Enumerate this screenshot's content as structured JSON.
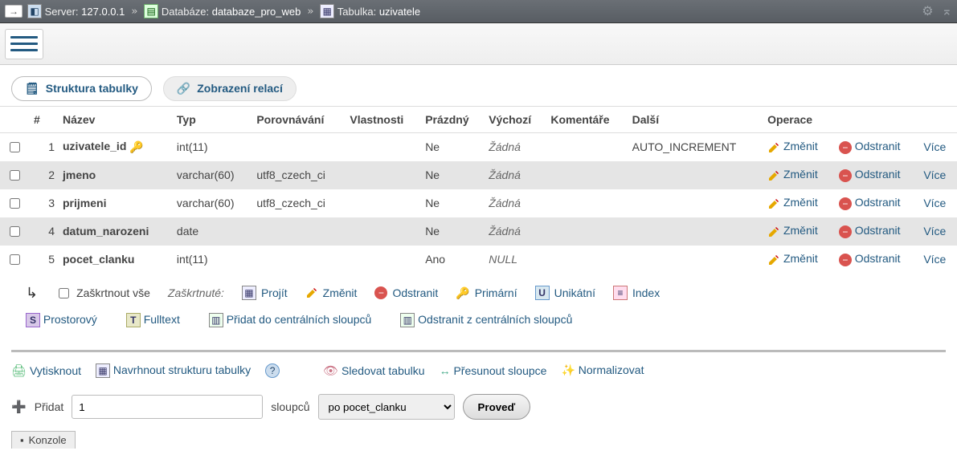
{
  "breadcrumb": {
    "server_label": "Server:",
    "server": "127.0.0.1",
    "db_label": "Databáze:",
    "db": "databaze_pro_web",
    "table_label": "Tabulka:",
    "table": "uzivatele"
  },
  "tabs": {
    "structure": "Struktura tabulky",
    "relations": "Zobrazení relací"
  },
  "columns_header": {
    "num": "#",
    "name": "Název",
    "type": "Typ",
    "collation": "Porovnávání",
    "attributes": "Vlastnosti",
    "null": "Prázdný",
    "default": "Výchozí",
    "comments": "Komentáře",
    "extra": "Další",
    "actions": "Operace"
  },
  "rows": [
    {
      "n": "1",
      "name": "uzivatele_id",
      "primary": true,
      "type": "int(11)",
      "collation": "",
      "null": "Ne",
      "def": "Žádná",
      "extra": "AUTO_INCREMENT"
    },
    {
      "n": "2",
      "name": "jmeno",
      "primary": false,
      "type": "varchar(60)",
      "collation": "utf8_czech_ci",
      "null": "Ne",
      "def": "Žádná",
      "extra": ""
    },
    {
      "n": "3",
      "name": "prijmeni",
      "primary": false,
      "type": "varchar(60)",
      "collation": "utf8_czech_ci",
      "null": "Ne",
      "def": "Žádná",
      "extra": ""
    },
    {
      "n": "4",
      "name": "datum_narozeni",
      "primary": false,
      "type": "date",
      "collation": "",
      "null": "Ne",
      "def": "Žádná",
      "extra": ""
    },
    {
      "n": "5",
      "name": "pocet_clanku",
      "primary": false,
      "type": "int(11)",
      "collation": "",
      "null": "Ano",
      "def": "NULL",
      "extra": ""
    }
  ],
  "row_actions": {
    "edit": "Změnit",
    "drop": "Odstranit",
    "more": "Více"
  },
  "bulk": {
    "check_all": "Zaškrtnout vše",
    "with_selected": "Zaškrtnuté:",
    "browse": "Projít",
    "edit": "Změnit",
    "drop": "Odstranit",
    "primary": "Primární",
    "unique": "Unikátní",
    "index": "Index",
    "spatial": "Prostorový",
    "fulltext": "Fulltext",
    "add_central": "Přidat do centrálních sloupců",
    "remove_central": "Odstranit z centrálních sloupců"
  },
  "footer": {
    "print": "Vytisknout",
    "propose": "Navrhnout strukturu tabulky",
    "track": "Sledovat tabulku",
    "move": "Přesunout sloupce",
    "normalize": "Normalizovat"
  },
  "add": {
    "label": "Přidat",
    "count": "1",
    "columns_word": "sloupců",
    "position": "po pocet_clanku",
    "go": "Proveď"
  },
  "console": "Konzole"
}
